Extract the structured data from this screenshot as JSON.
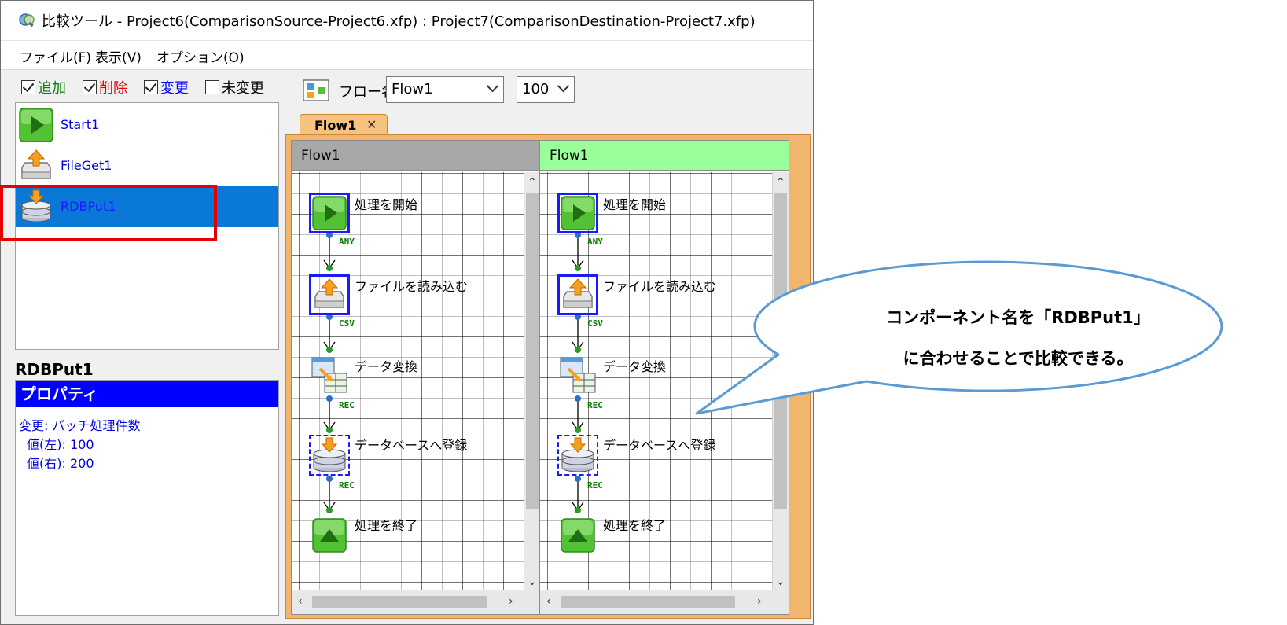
{
  "window": {
    "title": "比較ツール - Project6(ComparisonSource-Project6.xfp) : Project7(ComparisonDestination-Project7.xfp)",
    "icon": "compare-tool-icon"
  },
  "menu": [
    "ファイル(F)",
    "表示(V)",
    "オプション(O)"
  ],
  "filters": [
    {
      "label": "追加",
      "checked": true,
      "color": "#008000"
    },
    {
      "label": "削除",
      "checked": true,
      "color": "#e60000"
    },
    {
      "label": "変更",
      "checked": true,
      "color": "#0000ff"
    },
    {
      "label": "未変更",
      "checked": false,
      "color": "#000000"
    }
  ],
  "components": [
    {
      "label": "Start1",
      "icon": "start-icon",
      "selected": false
    },
    {
      "label": "FileGet1",
      "icon": "file-get-icon",
      "selected": false
    },
    {
      "label": "RDBPut1",
      "icon": "database-put-icon",
      "selected": true
    }
  ],
  "properties": {
    "name": "RDBPut1",
    "header": "プロパティ",
    "lines": [
      "変更: バッチ処理件数",
      "値(左): 100",
      "値(右): 200"
    ]
  },
  "toolbar": {
    "flow_name_label": "フロー名",
    "flow_select": "Flow1",
    "zoom_select": "100"
  },
  "tab": {
    "label": "Flow1",
    "close": "✕"
  },
  "panes": [
    {
      "header": "Flow1",
      "header_color": "#a8a8a8"
    },
    {
      "header": "Flow1",
      "header_color": "#99ff99"
    }
  ],
  "flow_nodes": [
    {
      "label": "処理を開始",
      "icon": "start-icon",
      "frame": "solid"
    },
    {
      "label": "ファイルを読み込む",
      "icon": "file-get-icon",
      "frame": "solid"
    },
    {
      "label": "データ変換",
      "icon": "data-transform-icon",
      "frame": "none"
    },
    {
      "label": "データベースへ登録",
      "icon": "database-put-icon",
      "frame": "dashed"
    },
    {
      "label": "処理を終了",
      "icon": "end-icon",
      "frame": "none"
    }
  ],
  "connectors": [
    "ANY",
    "CSV",
    "REC",
    "REC"
  ],
  "callout": {
    "line1": "コンポーネント名を「RDBPut1」",
    "line2": "に合わせることで比較できる。"
  }
}
